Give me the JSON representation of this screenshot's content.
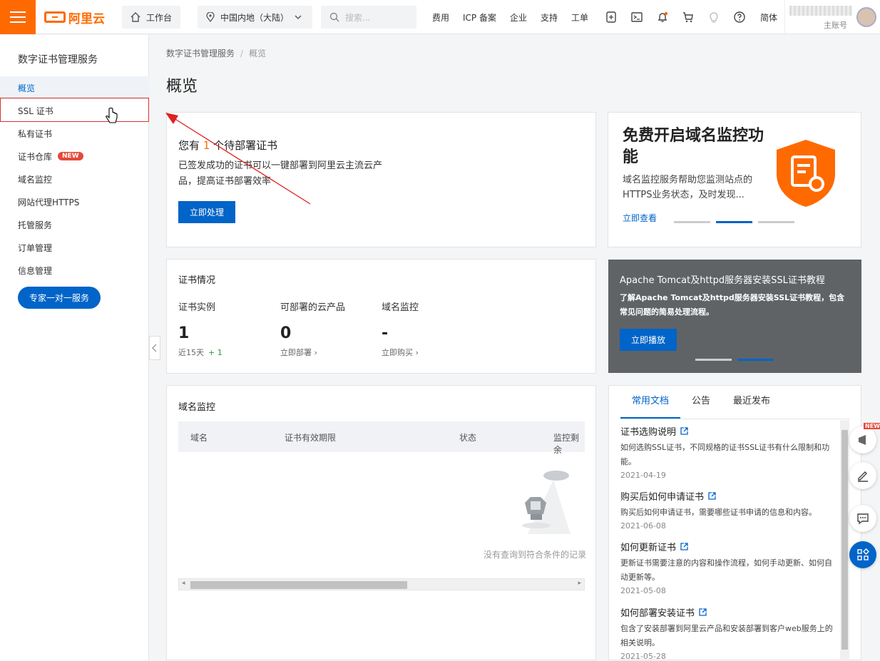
{
  "topbar": {
    "workbench": "工作台",
    "region": "中国内地（大陆）",
    "search_placeholder": "搜索...",
    "nav": [
      "费用",
      "ICP 备案",
      "企业",
      "支持",
      "工单"
    ],
    "lang": "简体",
    "account_sub": "主账号",
    "logo_text": "阿里云"
  },
  "sidebar": {
    "title": "数字证书管理服务",
    "items": [
      {
        "label": "概览"
      },
      {
        "label": "SSL 证书"
      },
      {
        "label": "私有证书"
      },
      {
        "label": "证书仓库",
        "badge": "NEW"
      },
      {
        "label": "域名监控"
      },
      {
        "label": "网站代理HTTPS"
      },
      {
        "label": "托管服务"
      },
      {
        "label": "订单管理"
      },
      {
        "label": "信息管理"
      }
    ],
    "expert_button": "专家一对一服务"
  },
  "breadcrumb": {
    "root": "数字证书管理服务",
    "sep": "/",
    "current": "概览"
  },
  "page_title": "概览",
  "pending": {
    "prefix": "您有",
    "count": "1",
    "suffix": "个待部署证书",
    "desc": "已签发成功的证书可以一键部署到阿里云主流云产品，提高证书部署效率",
    "button": "立即处理"
  },
  "promo": {
    "title": "免费开启域名监控功能",
    "desc": "域名监控服务帮助您监测站点的HTTPS业务状态，及时发现...",
    "link": "立即查看"
  },
  "cert_status": {
    "title": "证书情况",
    "instance_label": "证书实例",
    "instance_value": "1",
    "instance_foot": "近15天",
    "instance_delta": "+ 1",
    "cloud_label": "可部署的云产品",
    "cloud_value": "0",
    "cloud_link": "立即部署",
    "monitor_label": "域名监控",
    "monitor_value": "-",
    "monitor_link": "立即购买"
  },
  "tutorial": {
    "title": "Apache Tomcat及httpd服务器安装SSL证书教程",
    "desc": "了解Apache Tomcat及httpd服务器安装SSL证书教程，包含常见问题的简易处理流程。",
    "button": "立即播放"
  },
  "domain_monitor": {
    "title": "域名监控",
    "columns": [
      "域名",
      "证书有效期限",
      "状态",
      "监控剩余"
    ],
    "empty": "没有查询到符合条件的记录"
  },
  "docs": {
    "tabs": [
      "常用文档",
      "公告",
      "最近发布"
    ],
    "items": [
      {
        "title": "证书选购说明",
        "desc": "如何选购SSL证书，不同规格的证书SSL证书有什么限制和功能。",
        "date": "2021-04-19"
      },
      {
        "title": "购买后如何申请证书",
        "desc": "购买后如何申请证书，需要哪些证书申请的信息和内容。",
        "date": "2021-06-08"
      },
      {
        "title": "如何更新证书",
        "desc": "更新证书需要注意的内容和操作流程，如何手动更新、如何自动更新等。",
        "date": "2021-05-08"
      },
      {
        "title": "如何部署安装证书",
        "desc": "包含了安装部署到阿里云产品和安装部署到客户web服务上的相关说明。",
        "date": "2021-05-28"
      }
    ]
  },
  "float_new": "NEW",
  "colors": {
    "brand": "#ff6a00",
    "primary": "#0064c8",
    "badge": "#e5493a"
  }
}
